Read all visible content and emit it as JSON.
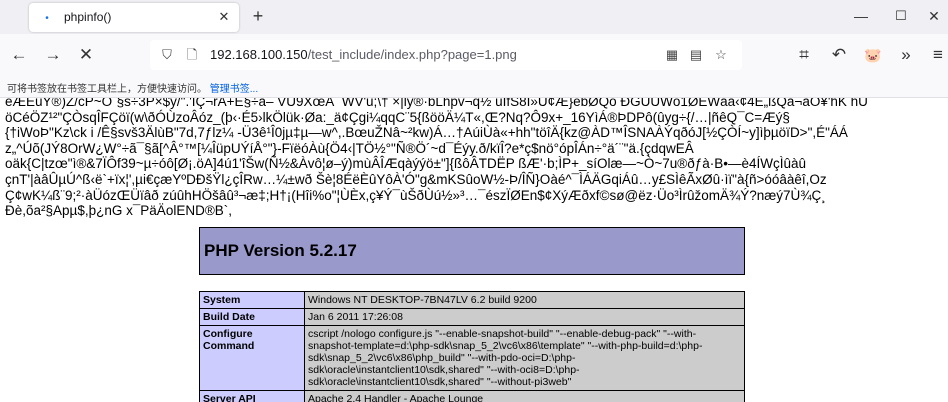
{
  "tab": {
    "title": "phpinfo()",
    "close_icon": "close-icon"
  },
  "window": {
    "minimize": "—",
    "maximize": "☐",
    "close": "✕"
  },
  "nav": {
    "url_host": "192.168.100.150",
    "url_rest": "/test_include/index.php?page=1.png"
  },
  "bookmarks": {
    "text": "可将书签放在书签工具栏上，方便快速访问。",
    "link": "管理书签..."
  },
  "garbage_lines": [
    "eÆÈûY®)Z/cP~Ó`§s÷3P×$y/\".'IÇ¬rA+E§÷ä– VU9XœA¯WV'u;\\† ×|ly®·bLhpv¬q½ uIfS8I»Ü¢Æ}èbØQö ÐGÙÙWö1ØEWàä‹¢4E„ßQä¬äO¥'hK hU",
    "öCéÖZ¹²\"ÇÒsqÎFÇöï(w\\ðÓÙzoÂóz_(þ‹·É5›lkÖlük·Øa:_ä¢Çgi¼qqC¨5{ßööÄ¼T«,Œ?Nq?Ô9x+_16YìÁ®ÞDPô(ûyg÷{/…|ñêQ¯C=Æý§",
    "{†iWoÞ\"Kz\\ck i /Ê§svš3ÄlùB\"7d,7ƒlz¼ -Ü3ê¹Î0jµ‡µ—w^,.BœuŽNâ~²kw)Á…†AúiÙà«+hh\"töîÄ{kz@ÀD™ÎSNAÀÝqðóJ[½ÇÒÍ~y]ìþµöïD>\",É\"ÁÁ",
    "z„^Úõ(JÝ8OrW¿W°÷ã¯§ã[^Â°™[¼ÎüpUÝíÅ°\"}-FïëóÀù{Ö4‹|TÖ½°\"Ñ®Ö´~d¯Éýy.ð/kïÎ?e*ç$nö°ópÎÁn÷°ä´¨\"ä.{çdqwEÂ",
    "oäk{C|tzœ\"ì®&7ÏÔf39~µ÷óô[Ø¡.öA]4ú1'îŠw(Ñ½&Àvô¦ø–ý)mùÂÎÆqàýýö±\"]{ßôÂTDËP ßÆ'·b;ÌP+_síOlæ—~Ò~7u®ðƒà·B•—è4ÍWçÌûàû",
    "çnT'|àâÛµÚ^ß‹ë`+ïx¦',µi€çæYºDÐšŸl¿çÎRw…¼±wð  Šè¦8ÉëÈûYôÀ'Ó\"g&mKSûoW½-Þ/ÎÑ}Oàé^¯ÌÁÄGqiÁû…y£SÌêÃxØû·ìï\"à{ñ>óóâàêî,Oz",
    "Ç¢wK¼ß¨9;²·àÜózŒÜïâð zúûhHÖšâû³¬æ‡;H†¡(Hîi%o\"¦ÙÈx,ç¥Ý¯ùŠðÙú½»³…¯észÏØEn$¢XýÆðxf©sø@ëz·Üo³ÌrûžomÄ¾Ý?næý7Ù¾Ç¸",
    "Ðè,õa²§Apµ$,þ¿nG x¯PäÄolEND®B`,"
  ],
  "php": {
    "version_title": "PHP Version 5.2.17",
    "rows": [
      {
        "key": "System",
        "value": "Windows NT DESKTOP-7BN47LV 6.2 build 9200"
      },
      {
        "key": "Build Date",
        "value": "Jan 6 2011 17:26:08"
      },
      {
        "key": "Configure Command",
        "value": "cscript /nologo configure.js \"--enable-snapshot-build\" \"--enable-debug-pack\" \"--with-snapshot-template=d:\\php-sdk\\snap_5_2\\vc6\\x86\\template\" \"--with-php-build=d:\\php-sdk\\snap_5_2\\vc6\\x86\\php_build\" \"--with-pdo-oci=D:\\php-sdk\\oracle\\instantclient10\\sdk,shared\" \"--with-oci8=D:\\php-sdk\\oracle\\instantclient10\\sdk,shared\" \"--without-pi3web\""
      },
      {
        "key": "Server API",
        "value": "Apache 2.4 Handler - Apache Lounge"
      }
    ]
  }
}
